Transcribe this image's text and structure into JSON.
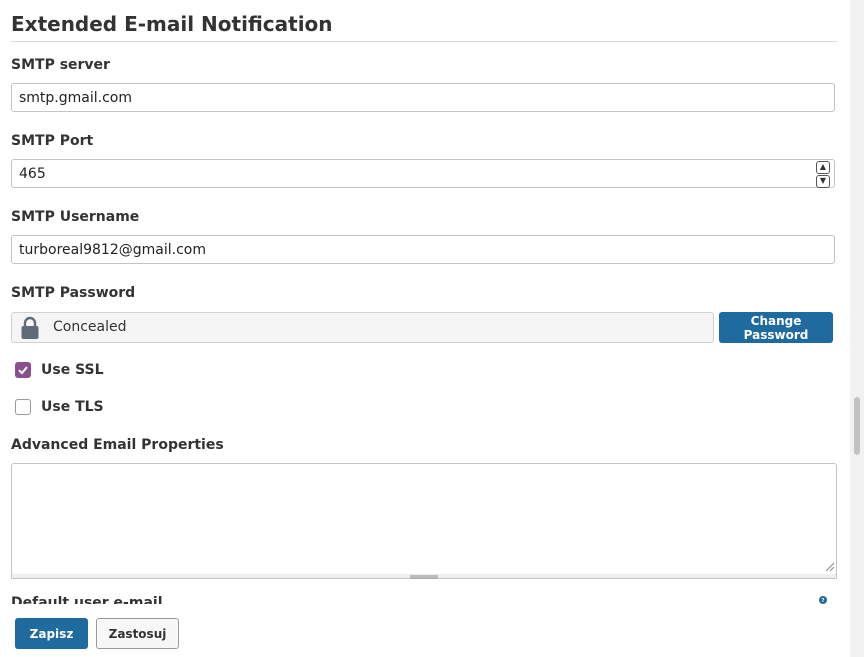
{
  "section": {
    "title": "Extended E-mail Notification"
  },
  "smtp_server": {
    "label": "SMTP server",
    "value": "smtp.gmail.com"
  },
  "smtp_port": {
    "label": "SMTP Port",
    "value": "465",
    "up_glyph": "▲",
    "down_glyph": "▼"
  },
  "smtp_username": {
    "label": "SMTP Username",
    "value": "turboreal9812@gmail.com"
  },
  "smtp_password": {
    "label": "SMTP Password",
    "status": "Concealed",
    "change_button": "Change Password"
  },
  "use_ssl": {
    "label": "Use SSL",
    "checked": true
  },
  "use_tls": {
    "label": "Use TLS",
    "checked": false
  },
  "advanced": {
    "label": "Advanced Email Properties",
    "value": ""
  },
  "cut_off": {
    "label": "Default user e-mail suffix"
  },
  "buttons": {
    "save": "Zapisz",
    "apply": "Zastosuj"
  },
  "colors": {
    "primary": "#1f6ba0",
    "checkbox": "#8a4f8e",
    "help": "#1f6ba0"
  },
  "icons": {
    "lock": "lock-icon",
    "help": "help-icon",
    "check": "check-icon"
  }
}
